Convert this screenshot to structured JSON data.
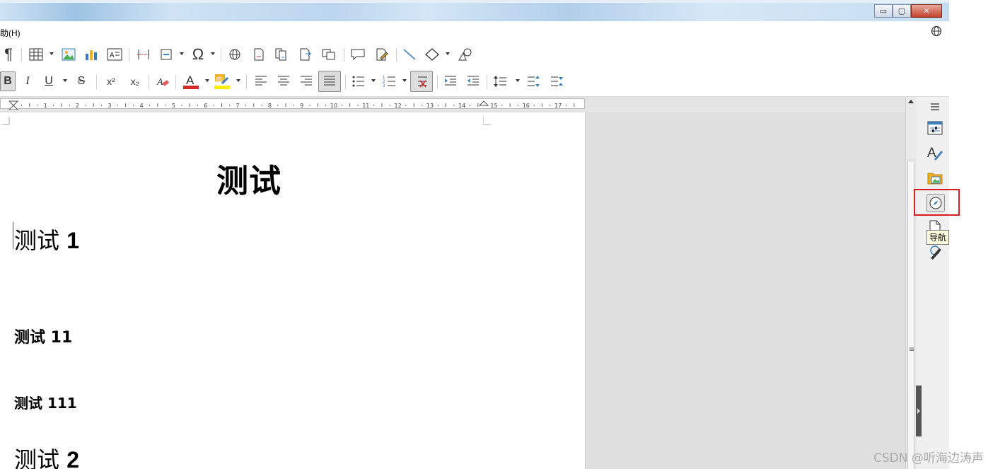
{
  "menu": {
    "help_label": "助(H)"
  },
  "window_buttons": {
    "minimize": "▭",
    "restore": "▢",
    "close": "✕"
  },
  "toolbar_format": {
    "bold": "B",
    "italic": "I",
    "underline": "U",
    "strike": "S",
    "superscript": "x²",
    "subscript": "x₂"
  },
  "ruler": {
    "numbers": [
      "1",
      "2",
      "3",
      "4",
      "5",
      "6",
      "7",
      "8",
      "9",
      "10",
      "11",
      "12",
      "13",
      "14",
      "15",
      "16",
      "17"
    ]
  },
  "document": {
    "title": "测试",
    "heading1a_text": "测试",
    "heading1a_num": "1",
    "heading2_text": "测试 11",
    "heading3_text": "测试 111",
    "heading1b_text": "测试",
    "heading1b_num": "2"
  },
  "sidebar": {
    "tooltip": "导航"
  },
  "watermark": "CSDN @听海边涛声",
  "colors": {
    "font_color": "#d42a2a",
    "highlight_color": "#ffee00",
    "highlight_frame": "#d81e1e"
  }
}
